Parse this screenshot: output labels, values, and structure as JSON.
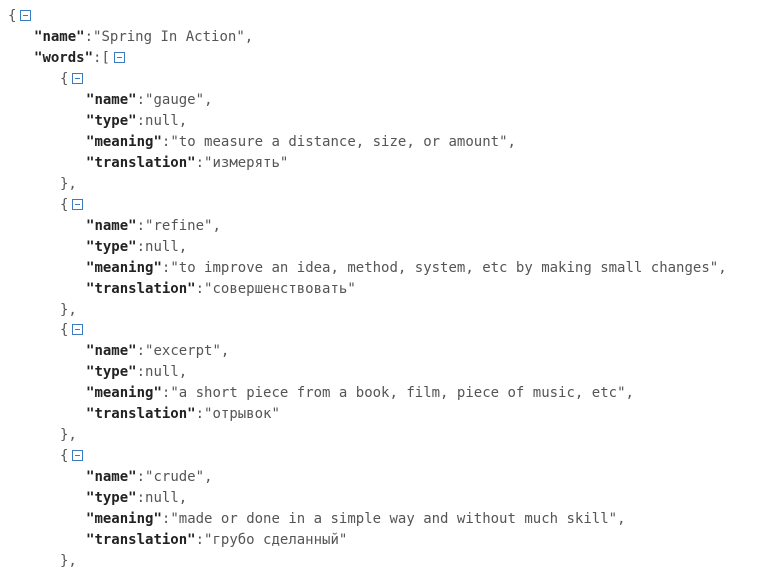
{
  "root": {
    "open_brace": "{",
    "name_key": "name",
    "name_value": "Spring In Action",
    "words_key": "words",
    "open_bracket": "["
  },
  "field_keys": {
    "name": "name",
    "type": "type",
    "meaning": "meaning",
    "translation": "translation"
  },
  "null_literal": "null",
  "words": [
    {
      "name": "gauge",
      "type": null,
      "meaning": "to measure a distance, size, or amount",
      "translation": "измерять"
    },
    {
      "name": "refine",
      "type": null,
      "meaning": "to improve an idea, method, system, etc by making small changes",
      "translation": "совершенствовать"
    },
    {
      "name": "excerpt",
      "type": null,
      "meaning": "a short piece from a book, film, piece of music, etc",
      "translation": "отрывок"
    },
    {
      "name": "crude",
      "type": null,
      "meaning": "made or done in a simple way and without much skill",
      "translation": "грубо сделанный"
    }
  ],
  "icons": {
    "collapse": "collapse-icon"
  },
  "colors": {
    "toggle": "#3c7bbf",
    "key": "#222222",
    "value": "#555555"
  }
}
